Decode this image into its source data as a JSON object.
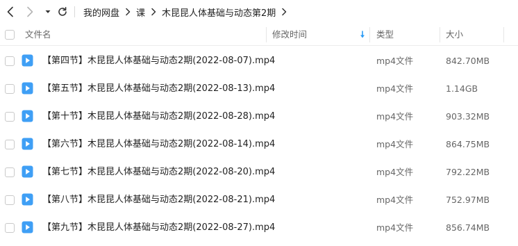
{
  "breadcrumb": [
    "我的网盘",
    "课",
    "木昆昆人体基础与动态第2期"
  ],
  "header": {
    "name": "文件名",
    "modified": "修改时间",
    "type": "类型",
    "size": "大小"
  },
  "colors": {
    "accent": "#2a9bf5",
    "icon": "#3f9ff5"
  },
  "files": [
    {
      "name": "【第四节】木昆昆人体基础与动态2期(2022-08-07).mp4",
      "type": "mp4文件",
      "size": "842.70MB"
    },
    {
      "name": "【第五节】木昆昆人体基础与动态2期(2022-08-13).mp4",
      "type": "mp4文件",
      "size": "1.14GB"
    },
    {
      "name": "【第十节】木昆昆人体基础与动态2期(2022-08-28).mp4",
      "type": "mp4文件",
      "size": "903.32MB"
    },
    {
      "name": "【第六节】木昆昆人体基础与动态2期(2022-08-14).mp4",
      "type": "mp4文件",
      "size": "864.75MB"
    },
    {
      "name": "【第七节】木昆昆人体基础与动态2期(2022-08-20).mp4",
      "type": "mp4文件",
      "size": "792.22MB"
    },
    {
      "name": "【第八节】木昆昆人体基础与动态2期(2022-08-21).mp4",
      "type": "mp4文件",
      "size": "752.97MB"
    },
    {
      "name": "【第九节】木昆昆人体基础与动态2期(2022-08-27).mp4",
      "type": "mp4文件",
      "size": "856.74MB"
    }
  ]
}
